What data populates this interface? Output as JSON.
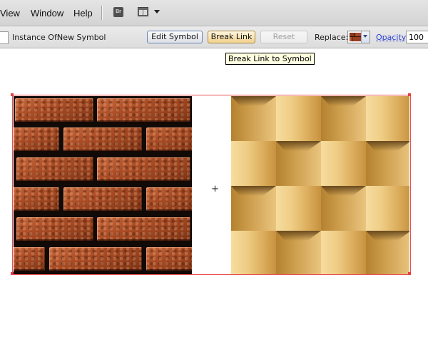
{
  "menu": {
    "items": [
      "View",
      "Window",
      "Help"
    ],
    "bridge_button_label": "Br"
  },
  "control_bar": {
    "instance_of_label": "Instance Of:",
    "symbol_name": "New Symbol",
    "edit_symbol_label": "Edit Symbol",
    "break_link_label": "Break Link",
    "reset_label": "Reset",
    "replace_label": "Replace:",
    "opacity_label": "Opacity:",
    "opacity_value": "100"
  },
  "tooltip": {
    "text": "Break Link to Symbol"
  },
  "canvas": {
    "left_artwork": "brick-pattern",
    "right_artwork": "woven-pattern"
  },
  "colors": {
    "menubar": "#d8d8d8",
    "selection": "#e85050",
    "tooltip_bg": "#ffffe1",
    "link": "#2a3fd0"
  }
}
